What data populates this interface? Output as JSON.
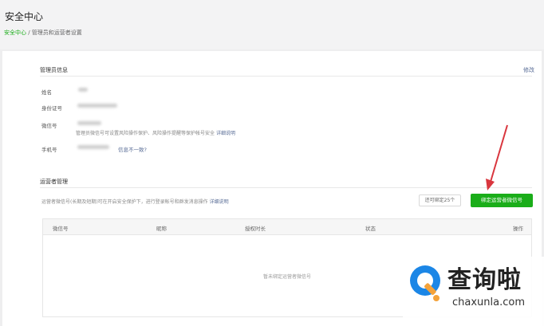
{
  "page": {
    "title": "安全中心",
    "breadcrumb": {
      "home": "安全中心",
      "separator": " / ",
      "current": "管理员和运营者设置"
    }
  },
  "admin": {
    "section_title": "管理员信息",
    "edit_label": "修改",
    "fields": [
      {
        "label": "姓名"
      },
      {
        "label": "身份证号"
      },
      {
        "label": "微信号"
      },
      {
        "label": "手机号"
      }
    ],
    "wechat_note": "管理员微信号可设置风险操作保护、风险操作提醒等保护帐号安全",
    "wechat_note_link": "详细说明",
    "phone_hint": "信息不一致?"
  },
  "operators": {
    "section_title": "运营者管理",
    "description": "运营者微信号(长期及短期)可在开启安全保护下，进行登录帐号和群发消息操作",
    "description_link": "详细说明",
    "remaining": "还可绑定25个",
    "bind_button": "绑定运营者微信号",
    "table": {
      "columns": [
        "微信号",
        "昵称",
        "授权时长",
        "状态",
        "操作"
      ],
      "empty_message": "暂未绑定运营者微信号"
    }
  },
  "watermark": {
    "chinese": "查询啦",
    "english": "chaxunla.com"
  },
  "colors": {
    "accent_green": "#1aad19",
    "link_blue": "#576b95",
    "arrow_red": "#d9363e"
  }
}
